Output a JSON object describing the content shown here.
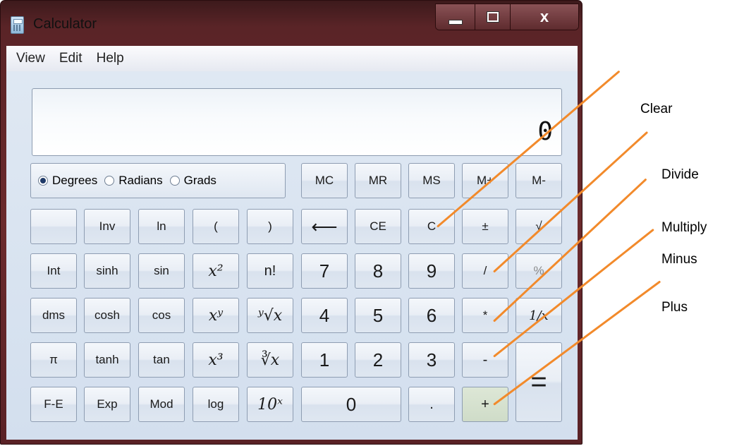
{
  "window": {
    "title": "Calculator",
    "close_label": "x"
  },
  "menu": [
    "View",
    "Edit",
    "Help"
  ],
  "display": {
    "value": "0"
  },
  "angle_mode": {
    "options": [
      "Degrees",
      "Radians",
      "Grads"
    ],
    "selected": "Degrees"
  },
  "buttons": {
    "mc": "MC",
    "mr": "MR",
    "ms": "MS",
    "mplus": "M+",
    "mminus": "M-",
    "inv": "Inv",
    "ln": "ln",
    "lparen": "(",
    "rparen": ")",
    "backspace": "⟵",
    "ce": "CE",
    "c": "C",
    "plusminus": "±",
    "sqrt": "√",
    "int": "Int",
    "sinh": "sinh",
    "sin": "sin",
    "x2": "x²",
    "fact": "n!",
    "seven": "7",
    "eight": "8",
    "nine": "9",
    "divide": "/",
    "percent": "%",
    "dms": "dms",
    "cosh": "cosh",
    "cos": "cos",
    "xy": "xʸ",
    "yroot": "ʸ√x",
    "four": "4",
    "five": "5",
    "six": "6",
    "multiply": "*",
    "reciprocal": "1/x",
    "pi": "π",
    "tanh": "tanh",
    "tan": "tan",
    "x3": "x³",
    "cuberoot": "∛x",
    "one": "1",
    "two": "2",
    "three": "3",
    "minus": "-",
    "equals": "=",
    "fe": "F-E",
    "exp": "Exp",
    "mod": "Mod",
    "log": "log",
    "tenx": "10ˣ",
    "zero": "0",
    "dot": ".",
    "plus": "+"
  },
  "annotations": [
    "Clear",
    "Divide",
    "Multiply",
    "Minus",
    "Plus"
  ],
  "colors": {
    "callout": "#f28a2b",
    "frame": "#5a2427",
    "panel": "#d9e4f1"
  }
}
